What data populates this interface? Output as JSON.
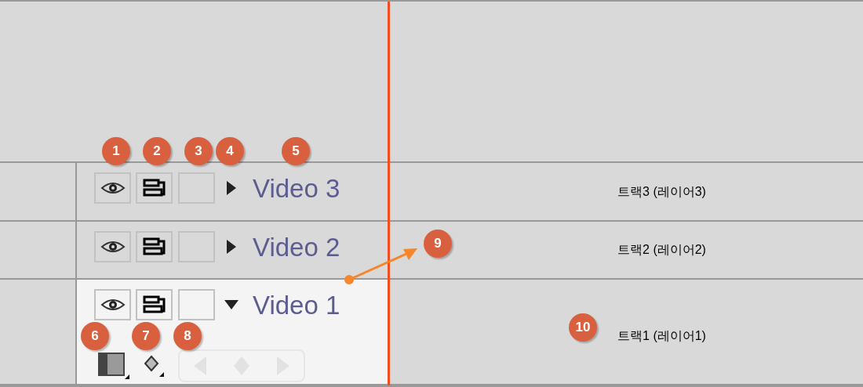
{
  "tracks": [
    {
      "name": "Video 3",
      "expanded": false,
      "label": "트랙3 (레이어3)"
    },
    {
      "name": "Video 2",
      "expanded": false,
      "label": "트랙2 (레이어2)"
    },
    {
      "name": "Video 1",
      "expanded": true,
      "label": "트랙1 (레이어1)"
    }
  ],
  "callouts": [
    "1",
    "2",
    "3",
    "4",
    "5",
    "6",
    "7",
    "8",
    "9",
    "10"
  ]
}
